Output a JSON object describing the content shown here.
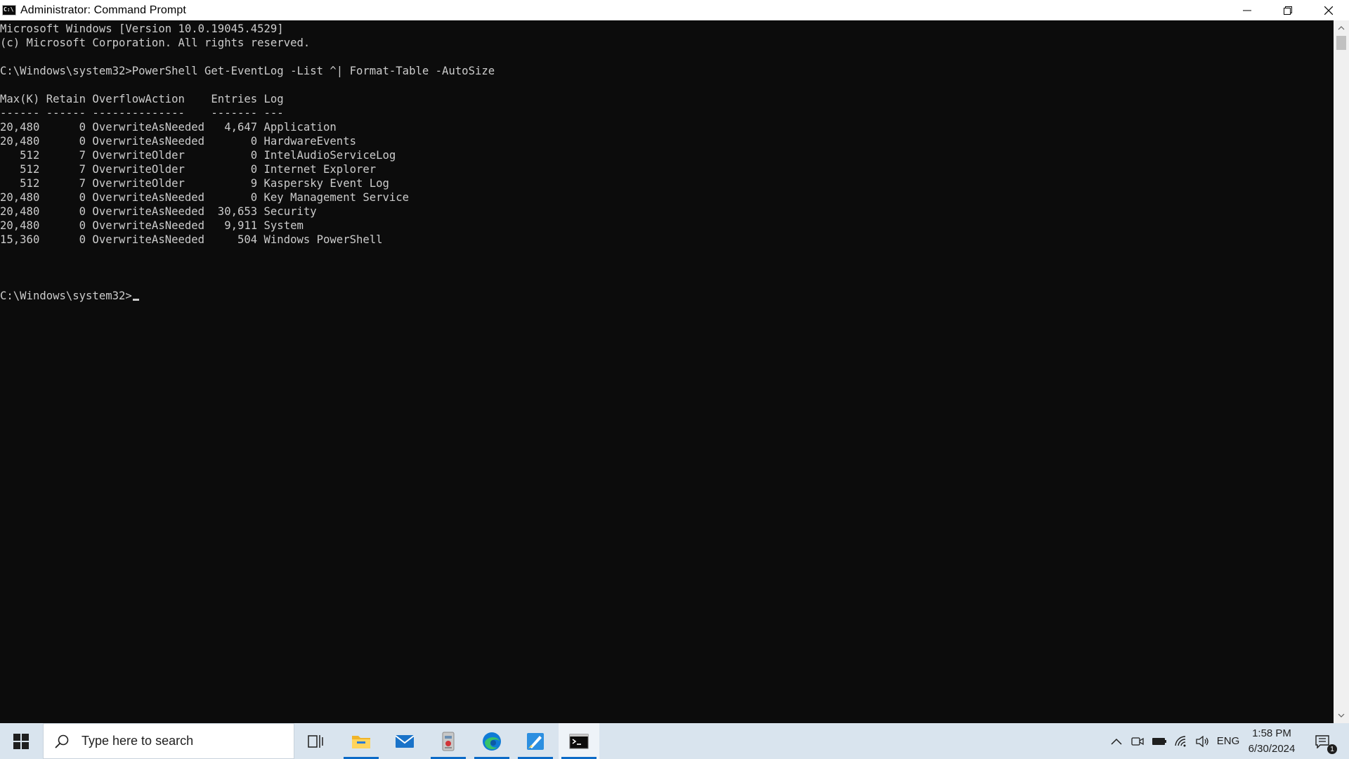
{
  "window": {
    "title": "Administrator: Command Prompt",
    "icon": "cmd-icon"
  },
  "console": {
    "lines": [
      "Microsoft Windows [Version 10.0.19045.4529]",
      "(c) Microsoft Corporation. All rights reserved.",
      "",
      "C:\\Windows\\system32>PowerShell Get-EventLog -List ^| Format-Table -AutoSize",
      "",
      "Max(K) Retain OverflowAction    Entries Log",
      "------ ------ --------------    ------- ---",
      "20,480      0 OverwriteAsNeeded   4,647 Application",
      "20,480      0 OverwriteAsNeeded       0 HardwareEvents",
      "   512      7 OverwriteOlder          0 IntelAudioServiceLog",
      "   512      7 OverwriteOlder          0 Internet Explorer",
      "   512      7 OverwriteOlder          9 Kaspersky Event Log",
      "20,480      0 OverwriteAsNeeded       0 Key Management Service",
      "20,480      0 OverwriteAsNeeded  30,653 Security",
      "20,480      0 OverwriteAsNeeded   9,911 System",
      "15,360      0 OverwriteAsNeeded     504 Windows PowerShell",
      "",
      "",
      "",
      "C:\\Windows\\system32>"
    ],
    "colors": {
      "background": "#0c0c0c",
      "foreground": "#cccccc"
    }
  },
  "taskbar": {
    "search_placeholder": "Type here to search",
    "pinned": [
      {
        "name": "task-view",
        "icon": "task-view-icon"
      },
      {
        "name": "file-explorer",
        "icon": "folder-icon"
      },
      {
        "name": "mail",
        "icon": "mail-icon"
      },
      {
        "name": "installer",
        "icon": "installer-icon"
      },
      {
        "name": "edge",
        "icon": "edge-icon"
      },
      {
        "name": "paint",
        "icon": "paint-icon"
      },
      {
        "name": "command-prompt",
        "icon": "terminal-icon"
      }
    ],
    "tray": {
      "language": "ENG",
      "time": "1:58 PM",
      "date": "6/30/2024",
      "notification_count": "1"
    },
    "accent": "#0b6ac7"
  }
}
